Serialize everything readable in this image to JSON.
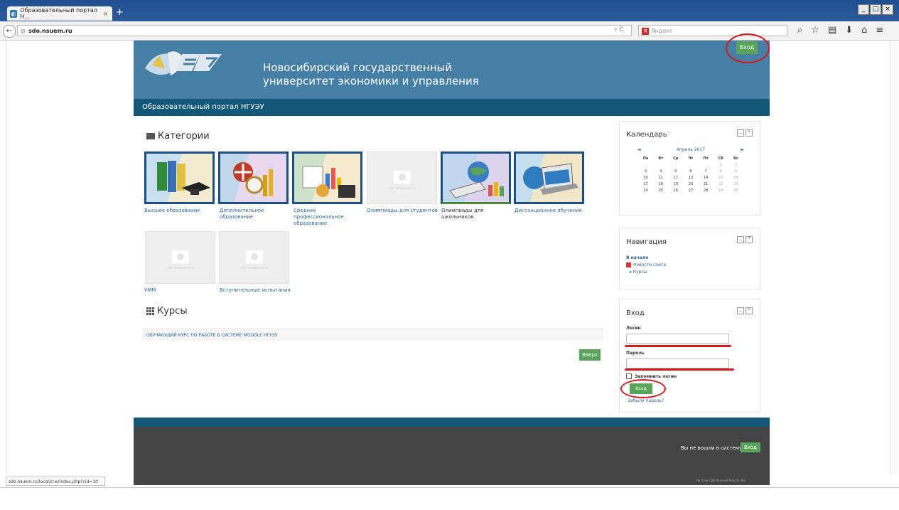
{
  "browser": {
    "tab_title": "Образовательный портал Н...",
    "tab_close": "×",
    "new_tab": "+",
    "url_host": "sdo.nsuem.ru",
    "search_placeholder": "Яндекс",
    "search_engine_letter": "Я",
    "reload_symbol": "C",
    "window_buttons": [
      "_",
      "□",
      "×"
    ],
    "status_url": "sdo.nsuem.ru/local/crw/index.php?cid=10"
  },
  "header": {
    "university_line1": "Новосибирский государственный",
    "university_line2": "университет экономики и управления",
    "login_button": "Вход",
    "portal_title": "Образовательный портал НГУЭУ"
  },
  "categories": {
    "heading": "Категории",
    "no_image_text": "Нет изображения",
    "items": [
      {
        "label": "Высшее образование"
      },
      {
        "label": "Дополнительное образование"
      },
      {
        "label": "Среднее профессиональное образование"
      },
      {
        "label": "Олимпиады для студентов"
      },
      {
        "label": "Олимпиады для школьников"
      },
      {
        "label": "Дистанционное обучение"
      },
      {
        "label": "УММ"
      },
      {
        "label": "Вступительные испытания"
      }
    ]
  },
  "courses": {
    "heading": "Курсы",
    "items": [
      "ОБУЧАЮЩИЙ КУРС ПО РАБОТЕ В СИСТЕМЕ MOODLE НГУЭУ"
    ],
    "up_button": "Вверх"
  },
  "calendar": {
    "title": "Календарь",
    "month": "Апрель 2017",
    "prev": "◄",
    "next": "►",
    "weekdays": [
      "Пн",
      "Вт",
      "Ср",
      "Чт",
      "Пт",
      "Сб",
      "Вс"
    ],
    "weeks": [
      [
        "",
        "",
        "",
        "",
        "",
        "1",
        "2"
      ],
      [
        "3",
        "4",
        "5",
        "6",
        "7",
        "8",
        "9"
      ],
      [
        "10",
        "11",
        "12",
        "13",
        "14",
        "15",
        "16"
      ],
      [
        "17",
        "18",
        "19",
        "20",
        "21",
        "22",
        "23"
      ],
      [
        "24",
        "25",
        "26",
        "27",
        "28",
        "29",
        "30"
      ]
    ]
  },
  "navigation": {
    "title": "Навигация",
    "home": "В начало",
    "news": "Новости сайта",
    "courses": "Курсы"
  },
  "login": {
    "title": "Вход",
    "username_label": "Логин",
    "password_label": "Пароль",
    "remember_label": "Запомнить логин",
    "submit": "Вход",
    "forgot": "Забыли пароль?"
  },
  "footer": {
    "status_text": "Вы не вошли в систему",
    "login_button": "Вход",
    "credit": "На базе СДО Русский Moodle 3KL"
  },
  "colors": {
    "header_bg": "#467fa6",
    "subnav_bg": "#135878",
    "button_green": "#5aa35a",
    "annotation_red": "#d9181e"
  }
}
